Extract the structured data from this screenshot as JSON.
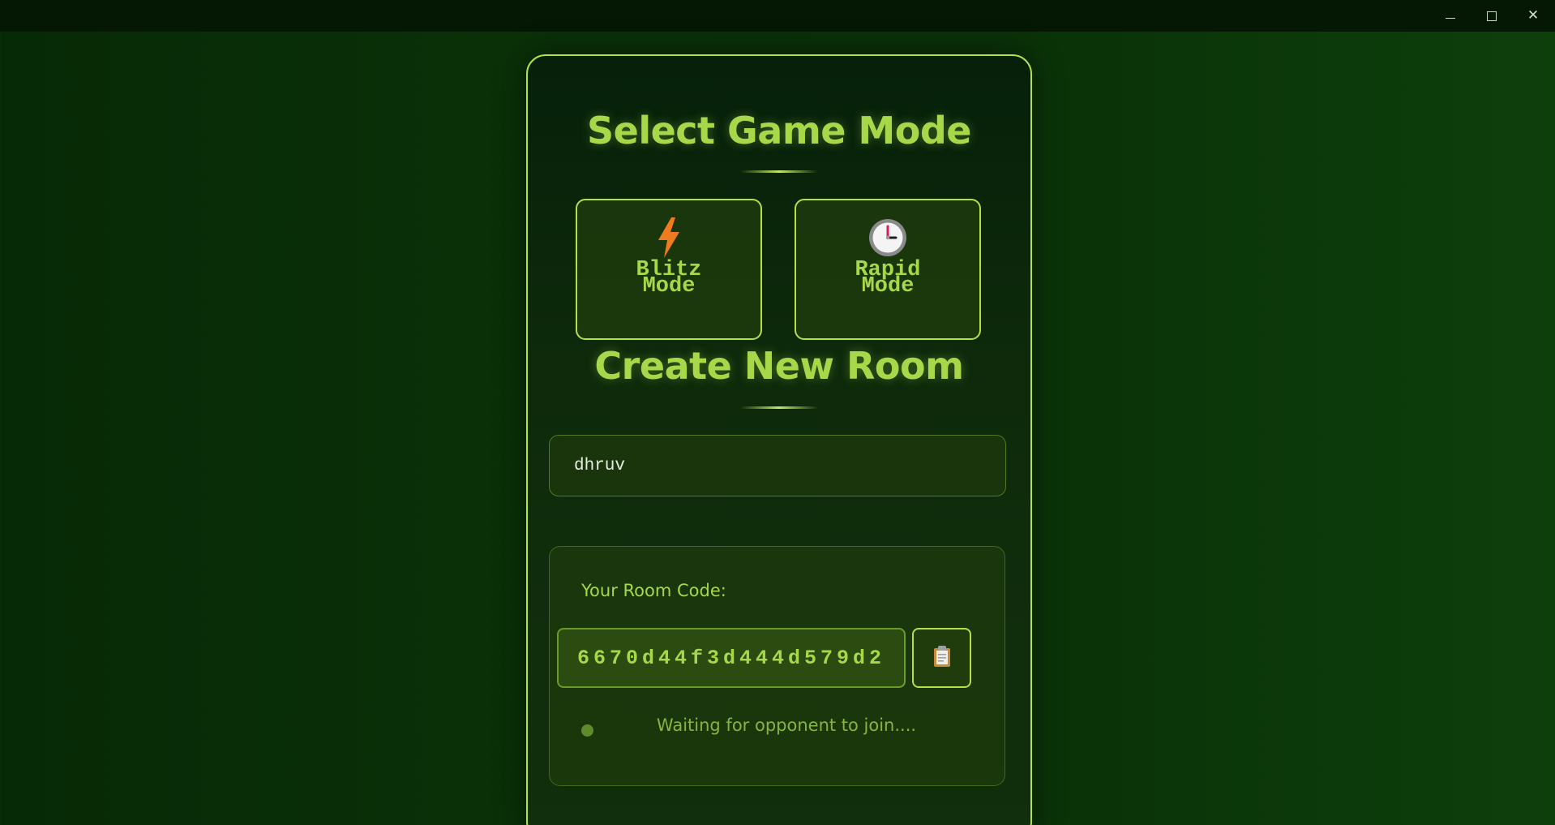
{
  "window": {
    "controls": {
      "minimize": "minimize-icon",
      "maximize": "maximize-icon",
      "close": "close-icon"
    },
    "close_glyph": "✕"
  },
  "game_mode": {
    "title": "Select Game Mode",
    "modes": [
      {
        "label": "Blitz Mode",
        "icon": "lightning-icon",
        "icon_color": "#f07a1e"
      },
      {
        "label": "Rapid Mode",
        "icon": "clock-icon",
        "icon_color": "#d81b60"
      }
    ]
  },
  "create_room": {
    "title": "Create New Room",
    "name_input_value": "dhruv",
    "room_code_label": "Your Room Code:",
    "room_code": "6670d44f3d444d579d2",
    "copy_button_icon": "clipboard-icon",
    "status_text": "Waiting for opponent to join...."
  },
  "colors": {
    "accent": "#a6d84a",
    "border": "#b4e048",
    "background": "#0a3108"
  }
}
